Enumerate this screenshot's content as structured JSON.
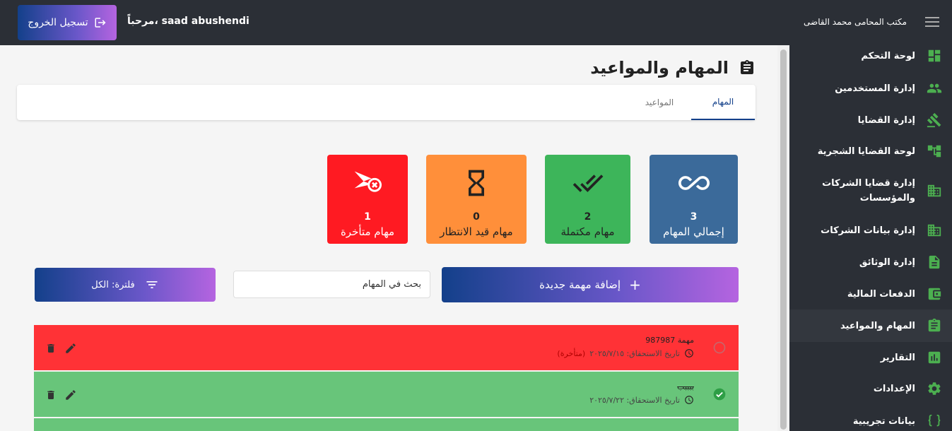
{
  "header": {
    "logout_label": "تسجيل الخروج",
    "welcome": "مرحباً، saad abushendi",
    "brand": "مكتب المحامى محمد القاضى"
  },
  "sidebar": {
    "items": [
      {
        "label": "لوحة التحكم",
        "icon": "dashboard-icon"
      },
      {
        "label": "إدارة المستخدمين",
        "icon": "users-icon"
      },
      {
        "label": "إدارة القضايا",
        "icon": "gavel-icon"
      },
      {
        "label": "لوحة القضايا الشجرية",
        "icon": "tree-icon"
      },
      {
        "label": "إدارة قضايا الشركات والمؤسسات",
        "icon": "building-icon"
      },
      {
        "label": "إدارة بيانات الشركات",
        "icon": "building-icon"
      },
      {
        "label": "إدارة الوثائق",
        "icon": "document-icon"
      },
      {
        "label": "الدفعات المالية",
        "icon": "wallet-icon"
      },
      {
        "label": "المهام والمواعيد",
        "icon": "clipboard-icon",
        "active": true
      },
      {
        "label": "التقارير",
        "icon": "report-icon"
      },
      {
        "label": "الإعدادات",
        "icon": "gear-icon"
      },
      {
        "label": "بيانات تجريبية",
        "icon": "braces-icon"
      }
    ]
  },
  "page": {
    "title": "المهام والمواعيد",
    "tabs": [
      {
        "label": "المهام",
        "active": true
      },
      {
        "label": "المواعيد",
        "active": false
      }
    ]
  },
  "stats": {
    "total": {
      "value": "3",
      "label": "إجمالي المهام"
    },
    "completed": {
      "value": "2",
      "label": "مهام مكتملة"
    },
    "pending": {
      "value": "0",
      "label": "مهام قيد الانتظار"
    },
    "overdue": {
      "value": "1",
      "label": "مهام متأخرة"
    }
  },
  "actions": {
    "add_label": "إضافة مهمة جديدة",
    "search_placeholder": "بحث في المهام",
    "filter_label": "فلترة: الكل"
  },
  "tasks": [
    {
      "title": "مهمة 987987",
      "due": "تاريخ الاستحقاق: ٢٠٢٥/٧/١٥",
      "tag": "(متأخرة)",
      "status": "overdue"
    },
    {
      "title": "ببببب",
      "due": "تاريخ الاستحقاق: ٢٠٢٥/٧/٢٢",
      "tag": "",
      "status": "completed"
    }
  ],
  "colors": {
    "topbar": "#2b2f36",
    "accent_gradient_start": "#13408a",
    "accent_gradient_end": "#b564e0",
    "sidebar_icon": "#4caf50",
    "total_card": "#3b6a9a",
    "completed_card": "#3db55a",
    "pending_card": "#ff8f3a",
    "overdue_card": "#ff1a22"
  }
}
